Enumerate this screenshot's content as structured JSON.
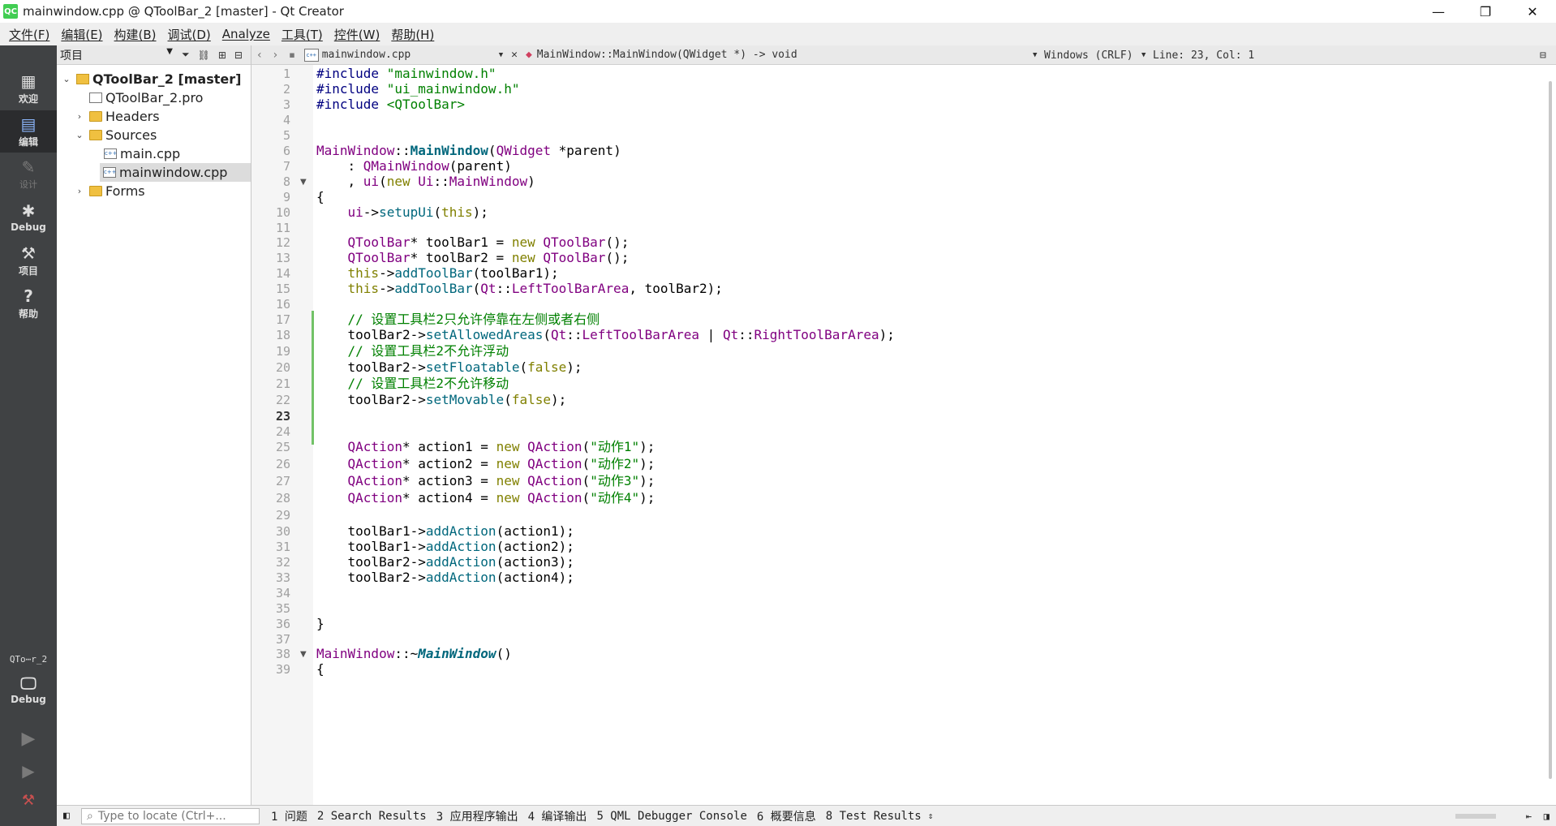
{
  "window": {
    "title": "mainwindow.cpp @ QToolBar_2 [master] - Qt Creator",
    "app_logo": "QC",
    "controls": [
      "—",
      "❐",
      "✕"
    ]
  },
  "menu": [
    "文件(F)",
    "编辑(E)",
    "构建(B)",
    "调试(D)",
    "Analyze",
    "工具(T)",
    "控件(W)",
    "帮助(H)"
  ],
  "modes": [
    {
      "label": "欢迎",
      "icon": "grid-icon"
    },
    {
      "label": "编辑",
      "icon": "edit-icon"
    },
    {
      "label": "设计",
      "icon": "pencil-icon"
    },
    {
      "label": "Debug",
      "icon": "bug-icon"
    },
    {
      "label": "项目",
      "icon": "wrench-icon"
    },
    {
      "label": "帮助",
      "icon": "help-icon"
    }
  ],
  "kit": {
    "name": "QTo⋯r_2",
    "label": "Debug"
  },
  "project_panel": {
    "selector": "项目",
    "tree": [
      {
        "label": "QToolBar_2 [master]",
        "bold": true
      },
      {
        "label": "QToolBar_2.pro"
      },
      {
        "label": "Headers"
      },
      {
        "label": "Sources"
      },
      {
        "label": "main.cpp"
      },
      {
        "label": "mainwindow.cpp"
      },
      {
        "label": "Forms"
      }
    ]
  },
  "editor_toolbar": {
    "file": "mainwindow.cpp",
    "symbol": "MainWindow::MainWindow(QWidget *) -> void",
    "line_ending": "Windows (CRLF)",
    "position": "Line: 23, Col: 1"
  },
  "code_lines": [
    "#include \"mainwindow.h\"",
    "#include \"ui_mainwindow.h\"",
    "#include <QToolBar>",
    "",
    "",
    "MainWindow::MainWindow(QWidget *parent)",
    "    : QMainWindow(parent)",
    "    , ui(new Ui::MainWindow)",
    "{",
    "    ui->setupUi(this);",
    "",
    "    QToolBar* toolBar1 = new QToolBar();",
    "    QToolBar* toolBar2 = new QToolBar();",
    "    this->addToolBar(toolBar1);",
    "    this->addToolBar(Qt::LeftToolBarArea, toolBar2);",
    "",
    "    // 设置工具栏2只允许停靠在左侧或者右侧",
    "    toolBar2->setAllowedAreas(Qt::LeftToolBarArea | Qt::RightToolBarArea);",
    "    // 设置工具栏2不允许浮动",
    "    toolBar2->setFloatable(false);",
    "    // 设置工具栏2不允许移动",
    "    toolBar2->setMovable(false);",
    "",
    "",
    "    QAction* action1 = new QAction(\"动作1\");",
    "    QAction* action2 = new QAction(\"动作2\");",
    "    QAction* action3 = new QAction(\"动作3\");",
    "    QAction* action4 = new QAction(\"动作4\");",
    "",
    "    toolBar1->addAction(action1);",
    "    toolBar1->addAction(action2);",
    "    toolBar2->addAction(action3);",
    "    toolBar2->addAction(action4);",
    "",
    "",
    "}",
    "",
    "MainWindow::~MainWindow()",
    "{"
  ],
  "line_numbers": [
    "1",
    "2",
    "3",
    "4",
    "5",
    "6",
    "7",
    "8",
    "9",
    "10",
    "11",
    "12",
    "13",
    "14",
    "15",
    "16",
    "17",
    "18",
    "19",
    "20",
    "21",
    "22",
    "23",
    "24",
    "25",
    "26",
    "27",
    "28",
    "29",
    "30",
    "31",
    "32",
    "33",
    "34",
    "35",
    "36",
    "37",
    "38",
    "39"
  ],
  "current_line": "23",
  "status": {
    "locate_placeholder": "Type to locate (Ctrl+...",
    "tabs": [
      "1 问题",
      "2 Search Results",
      "3 应用程序输出",
      "4 编译输出",
      "5 QML Debugger Console",
      "6 概要信息",
      "8 Test Results"
    ]
  },
  "colors": {
    "modebar": "#404244",
    "accent": "#72c267"
  }
}
